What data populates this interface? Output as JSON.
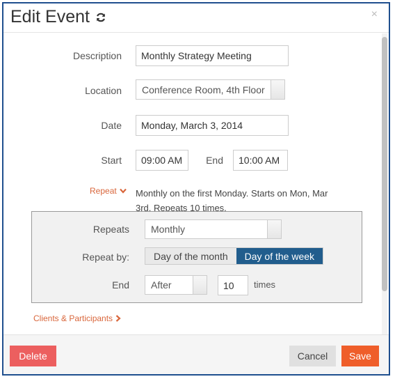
{
  "dialog": {
    "title": "Edit Event",
    "close_glyph": "×"
  },
  "form": {
    "description": {
      "label": "Description",
      "value": "Monthly Strategy Meeting"
    },
    "location": {
      "label": "Location",
      "value": "Conference Room, 4th Floor"
    },
    "date": {
      "label": "Date",
      "value": "Monday, March 3, 2014"
    },
    "start": {
      "label": "Start",
      "value": "09:00 AM"
    },
    "end": {
      "label": "End",
      "value": "10:00 AM"
    }
  },
  "repeat": {
    "link_label": "Repeat",
    "summary": "Monthly on the first Monday. Starts on Mon, Mar 3rd. Repeats 10 times.",
    "repeats_label": "Repeats",
    "repeats_value": "Monthly",
    "repeat_by_label": "Repeat by:",
    "repeat_by_options": [
      "Day of the month",
      "Day of the week"
    ],
    "repeat_by_selected": "Day of the week",
    "end_label": "End",
    "end_value": "After",
    "count": "10",
    "times_label": "times"
  },
  "clients_link": "Clients & Participants",
  "footer": {
    "delete_label": "Delete",
    "cancel_label": "Cancel",
    "save_label": "Save"
  },
  "colors": {
    "accent_orange": "#ef5e2a",
    "delete_red": "#ec5f5f",
    "selected_blue": "#215d8d",
    "link_orange": "#d9663b",
    "dialog_border": "#1f4f8e"
  },
  "icons": {
    "refresh": "refresh-icon",
    "close": "close-icon",
    "repeat_toggle": "chevron-down-icon",
    "clients_toggle": "chevron-right-icon"
  }
}
